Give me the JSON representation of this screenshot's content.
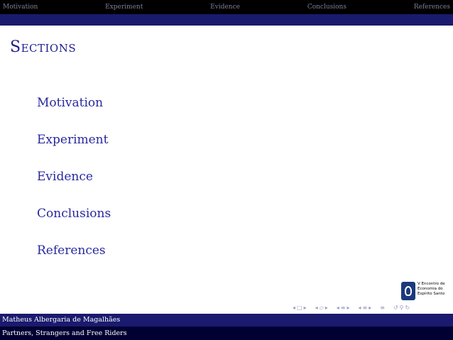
{
  "top_nav": {
    "items": [
      "Motivation",
      "Experiment",
      "Evidence",
      "Conclusions",
      "References"
    ]
  },
  "frame": {
    "title": "Sections"
  },
  "toc": {
    "items": [
      "Motivation",
      "Experiment",
      "Evidence",
      "Conclusions",
      "References"
    ]
  },
  "logo": {
    "lines": [
      "V Encontro de",
      "Economia do",
      "Espírito Santo"
    ]
  },
  "beamer_nav": {
    "icons": [
      "nav-prev-icon",
      "nav-frame-icon",
      "nav-next-icon",
      "nav-section-icon",
      "nav-search-icon",
      "nav-back-forward-icon"
    ]
  },
  "footer": {
    "author": "Matheus Albergaria de Magalhães",
    "title": "Partners, Strangers and Free Riders"
  },
  "colors": {
    "topbar": "#000000",
    "subbar": "#1a1a6e",
    "title": "#1e1e8c",
    "toc": "#2828a0",
    "footer_author_bg": "#1a1a6e",
    "footer_title_bg": "#000033"
  }
}
